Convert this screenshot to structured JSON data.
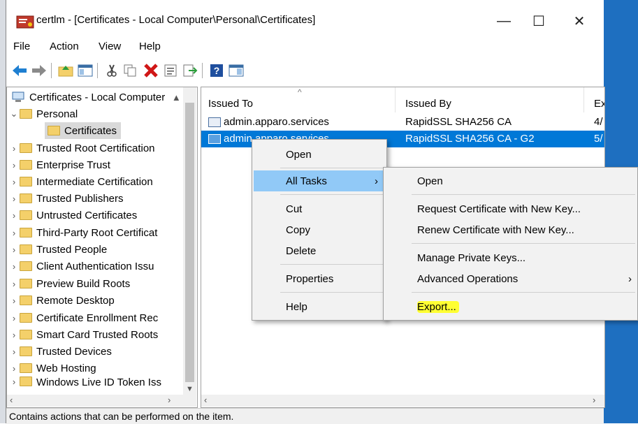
{
  "window": {
    "title": "certlm - [Certificates - Local Computer\\Personal\\Certificates]",
    "minimize": "—",
    "maximize": "☐",
    "close": "✕"
  },
  "menu": [
    "File",
    "Action",
    "View",
    "Help"
  ],
  "tree": {
    "root": "Certificates - Local Computer",
    "items": [
      {
        "label": "Personal",
        "expanded": true
      },
      {
        "label": "Certificates",
        "selected": true
      },
      {
        "label": "Trusted Root Certification"
      },
      {
        "label": "Enterprise Trust"
      },
      {
        "label": "Intermediate Certification"
      },
      {
        "label": "Trusted Publishers"
      },
      {
        "label": "Untrusted Certificates"
      },
      {
        "label": "Third-Party Root Certificat"
      },
      {
        "label": "Trusted People"
      },
      {
        "label": "Client Authentication Issu"
      },
      {
        "label": "Preview Build Roots"
      },
      {
        "label": "Remote Desktop"
      },
      {
        "label": "Certificate Enrollment Rec"
      },
      {
        "label": "Smart Card Trusted Roots"
      },
      {
        "label": "Trusted Devices"
      },
      {
        "label": "Web Hosting"
      },
      {
        "label": "Windows Live ID Token Iss"
      }
    ]
  },
  "list": {
    "columns": [
      "Issued To",
      "Issued By",
      "Ex"
    ],
    "rows": [
      {
        "issued_to": "admin.apparo.services",
        "issued_by": "RapidSSL SHA256 CA",
        "exp": "4/"
      },
      {
        "issued_to": "admin.apparo.services",
        "issued_by": "RapidSSL SHA256 CA - G2",
        "exp": "5/"
      }
    ]
  },
  "context_menu": {
    "open": "Open",
    "all_tasks": "All Tasks",
    "cut": "Cut",
    "copy": "Copy",
    "delete": "Delete",
    "properties": "Properties",
    "help": "Help"
  },
  "submenu": {
    "open": "Open",
    "request_new_key": "Request Certificate with New Key...",
    "renew_new_key": "Renew Certificate with New Key...",
    "manage_keys": "Manage Private Keys...",
    "advanced": "Advanced Operations",
    "export": "Export..."
  },
  "status": "Contains actions that can be performed on the item.",
  "colors": {
    "selection": "#0078d7",
    "highlight": "#ffff33",
    "desktop": "#1e6fc0"
  }
}
